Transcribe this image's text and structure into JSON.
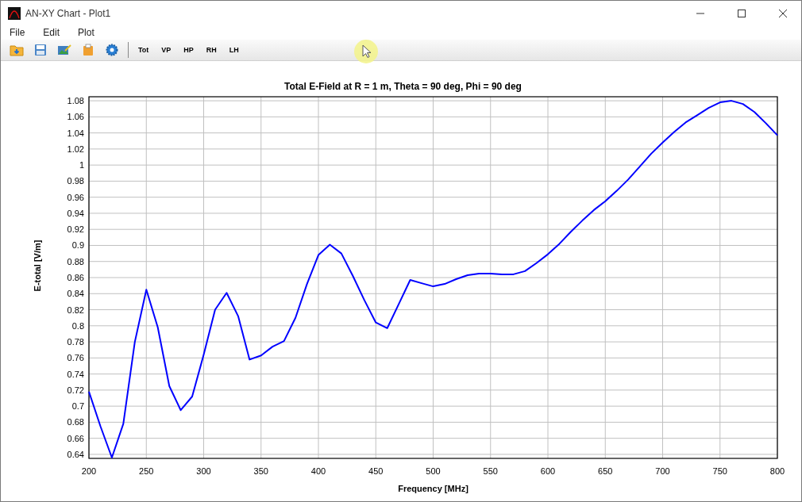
{
  "window": {
    "title": "AN-XY Chart - Plot1"
  },
  "menu": [
    "File",
    "Edit",
    "Plot"
  ],
  "toolbar": {
    "text_buttons": [
      "Tot",
      "VP",
      "HP",
      "RH",
      "LH"
    ]
  },
  "chart_data": {
    "type": "line",
    "title": "Total E-Field at R = 1 m, Theta = 90 deg, Phi = 90 deg",
    "xlabel": "Frequency [MHz]",
    "ylabel": "E-total [V/m]",
    "x": [
      200,
      210,
      220,
      230,
      240,
      250,
      260,
      270,
      280,
      290,
      300,
      310,
      320,
      330,
      340,
      350,
      360,
      370,
      380,
      390,
      400,
      410,
      420,
      430,
      440,
      450,
      460,
      470,
      480,
      490,
      500,
      510,
      520,
      530,
      540,
      550,
      560,
      570,
      580,
      590,
      600,
      610,
      620,
      630,
      640,
      650,
      660,
      670,
      680,
      690,
      700,
      710,
      720,
      730,
      740,
      750,
      760,
      770,
      780,
      790,
      800
    ],
    "series": [
      {
        "color": "#0000ff",
        "values": [
          0.718,
          0.675,
          0.636,
          0.678,
          0.78,
          0.845,
          0.798,
          0.725,
          0.695,
          0.712,
          0.764,
          0.82,
          0.841,
          0.812,
          0.758,
          0.763,
          0.774,
          0.781,
          0.81,
          0.852,
          0.888,
          0.901,
          0.89,
          0.862,
          0.832,
          0.804,
          0.797,
          0.827,
          0.857,
          0.853,
          0.849,
          0.852,
          0.858,
          0.863,
          0.865,
          0.865,
          0.864,
          0.864,
          0.868,
          0.878,
          0.889,
          0.902,
          0.917,
          0.931,
          0.944,
          0.955,
          0.968,
          0.982,
          0.998,
          1.014,
          1.028,
          1.041,
          1.053,
          1.062,
          1.071,
          1.078,
          1.08,
          1.076,
          1.066,
          1.052,
          1.037
        ]
      }
    ],
    "grid": true,
    "xlim": [
      200,
      800
    ],
    "ylim": [
      0.635,
      1.085
    ],
    "xticks": [
      200,
      250,
      300,
      350,
      400,
      450,
      500,
      550,
      600,
      650,
      700,
      750,
      800
    ],
    "yticks": [
      0.64,
      0.66,
      0.68,
      0.7,
      0.72,
      0.74,
      0.76,
      0.78,
      0.8,
      0.82,
      0.84,
      0.86,
      0.88,
      0.9,
      0.92,
      0.94,
      0.96,
      0.98,
      1,
      1.02,
      1.04,
      1.06,
      1.08
    ]
  }
}
